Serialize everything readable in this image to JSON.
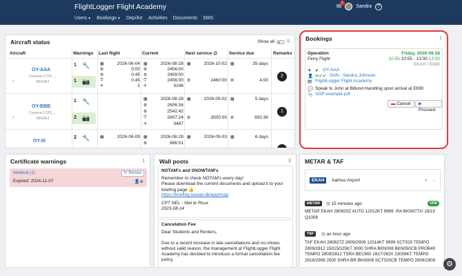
{
  "header": {
    "app_title": "FlightLogger Flight Academy",
    "user_name": "Sandra",
    "mail_count": "1",
    "help": "?",
    "nav": [
      "Users",
      "Bookings",
      "Dep/Arr",
      "Activities",
      "Documents",
      "SMS"
    ]
  },
  "aircraft": {
    "title": "Aircraft status",
    "show_all": "Show all",
    "count": "5",
    "columns": [
      "Aircraft",
      "Warnings",
      "Last flight",
      "Current",
      "Next service @",
      "Service due",
      "Remarks"
    ],
    "rows": [
      {
        "reg": "OY-AAA",
        "type": "Cessna 172S ...",
        "base": "EKAH",
        "w1": "1",
        "w2": "1",
        "last": [
          "2026-06-04",
          "0:00",
          "0:45",
          "0:45",
          "1"
        ],
        "current": [
          "2026-08-28",
          "2456:00",
          "2409:00",
          "2456:00",
          "3246"
        ],
        "next_date": "2026-10-02",
        "next_val": "2460:00",
        "due_days": "35 days",
        "due_val": "4:00",
        "remarks": "2"
      },
      {
        "reg": "OY-BBB",
        "type": "Cessna 172S ...",
        "base": "EKAH",
        "w1": "1",
        "w2": "2",
        "current": [
          "2026-08-28",
          "2606:34",
          "2542:42",
          "2607:24",
          "3487"
        ],
        "next_date": "2026-09-02",
        "next_val": "3500:00",
        "due_days": "5 days",
        "due_val": "892:36",
        "remarks": "1"
      },
      {
        "reg": "OY-III",
        "type": "",
        "base": "",
        "w1": "2",
        "w2": "",
        "last": [
          "2026-06-09"
        ],
        "current": [
          "2026-08-28",
          "886:51"
        ],
        "next_date": "2026-09-03",
        "next_val": "",
        "due_days": "6 days",
        "due_val": "",
        "remarks": ""
      }
    ]
  },
  "bookings": {
    "title": "Bookings",
    "count": "1",
    "op_label": "Operation",
    "op_value": "Ferry Flight",
    "date": "Friday, 2026-08-28",
    "time_a": "10:55",
    "time_b": "10:55 - 13:00",
    "time_c": "13:00",
    "route": "EKAH / EKBI",
    "aircraft": "OY-AAA",
    "people": "SAN - Sandra Johnson",
    "org": "FlightLogger Flight Academy",
    "remark": "Speak to John at Billund Handling upon arrival at EKBI",
    "attachment": "SOP example.pdf",
    "cancel": "Cancel",
    "proceed": "Proceed"
  },
  "cert": {
    "title": "Certificate warnings",
    "count": "1",
    "name": "Medical (1)",
    "renew": "Renew",
    "expired": "Expired: 2024-11-07"
  },
  "wall": {
    "title": "Wall posts",
    "count": "3",
    "p1": {
      "title": "NOTAM's and SNOWTAM's",
      "l1": "Remember to check NOTAM's every day!",
      "l2": "Please download the current documents and upload it to your",
      "l3": "briefing page 👍",
      "link": "https://briefing.naviair.dk/app/map",
      "author": "CPT NEL - Niel le Roux",
      "date": "2023-08-14"
    },
    "p2": {
      "title": "Cancelation Fee",
      "l1": "Dear Students and Renters,",
      "l2": "Due to a recent increase in late cancellations and no-shows",
      "l3": "without valid reason, the management at FlightLogger Flight",
      "l4": "Academy has decided to introduce a formal cancellation fee",
      "l5": "policy."
    }
  },
  "metar": {
    "title": "METAR & TAF",
    "airport_code": "EKAH",
    "airport_name": "Aarhus Airport",
    "clear": "×",
    "metar_tag": "METAR",
    "metar_age": "15 minutes ago",
    "vfr": "VFR",
    "metar_text": "METAR EKAH 280920Z AUTO 12012KT 9999 -RA BKN077/// 18/15 Q1008",
    "taf_tag": "TAF",
    "taf_age": "an hour ago",
    "taf_text": "TAF EKAH 280827Z 2809/2909 12014KT 9999 SCT020 TEMPO 2809/2812 15015G25KT 3000 SHRA BKN008 BKN050CB PROB40 TEMPO 2809/2812 TSRA BECMG 2817/2820 23008KT TEMPO 2818/2906 2500 SHRA BR BKN008 SCT020CB TEMPO 2906/2909"
  }
}
